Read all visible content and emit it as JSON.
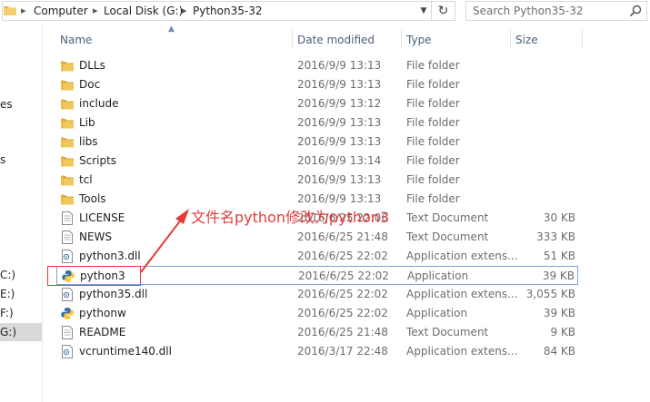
{
  "address": {
    "crumbs": [
      "Computer",
      "Local Disk (G:)",
      "Python35-32"
    ]
  },
  "search": {
    "placeholder": "Search Python35-32"
  },
  "nav": {
    "items": [
      "es",
      "s",
      "C:)",
      "E:)",
      "F:)",
      "G:)"
    ]
  },
  "columns": {
    "name": "Name",
    "date": "Date modified",
    "type": "Type",
    "size": "Size"
  },
  "files": [
    {
      "name": "DLLs",
      "date": "2016/9/9 13:13",
      "type": "File folder",
      "size": "",
      "icon": "folder-icon"
    },
    {
      "name": "Doc",
      "date": "2016/9/9 13:13",
      "type": "File folder",
      "size": "",
      "icon": "folder-icon"
    },
    {
      "name": "include",
      "date": "2016/9/9 13:12",
      "type": "File folder",
      "size": "",
      "icon": "folder-icon"
    },
    {
      "name": "Lib",
      "date": "2016/9/9 13:13",
      "type": "File folder",
      "size": "",
      "icon": "folder-icon"
    },
    {
      "name": "libs",
      "date": "2016/9/9 13:13",
      "type": "File folder",
      "size": "",
      "icon": "folder-icon"
    },
    {
      "name": "Scripts",
      "date": "2016/9/9 13:14",
      "type": "File folder",
      "size": "",
      "icon": "folder-icon"
    },
    {
      "name": "tcl",
      "date": "2016/9/9 13:13",
      "type": "File folder",
      "size": "",
      "icon": "folder-icon"
    },
    {
      "name": "Tools",
      "date": "2016/9/9 13:13",
      "type": "File folder",
      "size": "",
      "icon": "folder-icon"
    },
    {
      "name": "LICENSE",
      "date": "2016/6/25 22:06",
      "type": "Text Document",
      "size": "30 KB",
      "icon": "text-document-icon"
    },
    {
      "name": "NEWS",
      "date": "2016/6/25 21:48",
      "type": "Text Document",
      "size": "333 KB",
      "icon": "text-document-icon"
    },
    {
      "name": "python3.dll",
      "date": "2016/6/25 22:02",
      "type": "Application extens...",
      "size": "51 KB",
      "icon": "dll-icon"
    },
    {
      "name": "python3",
      "date": "2016/6/25 22:02",
      "type": "Application",
      "size": "39 KB",
      "icon": "python-icon"
    },
    {
      "name": "python35.dll",
      "date": "2016/6/25 22:02",
      "type": "Application extens...",
      "size": "3,055 KB",
      "icon": "dll-icon"
    },
    {
      "name": "pythonw",
      "date": "2016/6/25 22:02",
      "type": "Application",
      "size": "39 KB",
      "icon": "python-icon"
    },
    {
      "name": "README",
      "date": "2016/6/25 21:48",
      "type": "Text Document",
      "size": "9 KB",
      "icon": "text-document-icon"
    },
    {
      "name": "vcruntime140.dll",
      "date": "2016/3/17 22:48",
      "type": "Application extens...",
      "size": "84 KB",
      "icon": "dll-icon"
    }
  ],
  "selected_index": 11,
  "annotation": {
    "text": "文件名python修改为python3",
    "color": "#e33b3b"
  },
  "colors": {
    "folder": "#e8b84a",
    "selection_border": "#7da2ce",
    "header_text": "#4c607a"
  }
}
